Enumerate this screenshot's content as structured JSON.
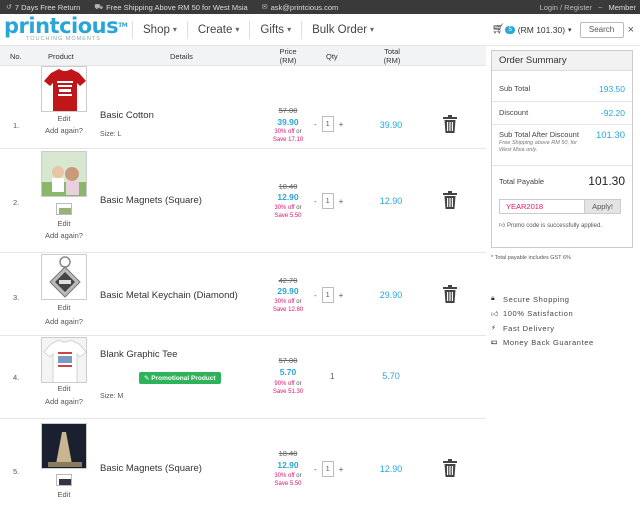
{
  "topbar": {
    "return_text": "7 Days Free Return",
    "shipping_text": "Free Shipping Above RM 50 for West Msia",
    "email": "ask@printcious.com",
    "login": "Login / Register",
    "separator": "~",
    "member": "Member"
  },
  "navbar": {
    "logo_text": "printcious",
    "logo_tm": "TM",
    "logo_tagline": "TOUCHING MOMENTS",
    "menu": [
      {
        "label": "Shop"
      },
      {
        "label": "Create"
      },
      {
        "label": "Gifts"
      },
      {
        "label": "Bulk Order"
      }
    ],
    "cart_count": "5",
    "cart_total": "(RM 101.30)",
    "search_label": "Search",
    "close_glyph": "×"
  },
  "table": {
    "headers": {
      "no": "No.",
      "product": "Product",
      "details": "Details",
      "price": "Price",
      "price_unit": "(RM)",
      "qty": "Qty",
      "total": "Total",
      "total_unit": "(RM)"
    },
    "edit_label": "Edit",
    "again_label": "Add again?",
    "or_label": "or",
    "items": [
      {
        "no": "1.",
        "name": "Basic Cotton",
        "size": "Size: L",
        "old_price": "57.00",
        "price": "39.90",
        "pct_off": "30% off",
        "save": "Save 17.10",
        "qty": "1",
        "total": "39.90",
        "minus": "-",
        "plus": "+"
      },
      {
        "no": "2.",
        "name": "Basic Magnets (Square)",
        "size": "",
        "old_price": "18.40",
        "price": "12.90",
        "pct_off": "30% off",
        "save": "Save 5.50",
        "qty": "1",
        "total": "12.90",
        "minus": "-",
        "plus": "+"
      },
      {
        "no": "3.",
        "name": "Basic Metal Keychain (Diamond)",
        "size": "",
        "old_price": "42.70",
        "price": "29.90",
        "pct_off": "30% off",
        "save": "Save 12.80",
        "qty": "1",
        "total": "29.90",
        "minus": "-",
        "plus": "+"
      },
      {
        "no": "4.",
        "name": "Blank Graphic Tee",
        "size": "Size: M",
        "badge": "Promotional Product",
        "old_price": "57.00",
        "price": "5.70",
        "pct_off": "90% off",
        "save": "Save 51.30",
        "qty": "1",
        "total": "5.70"
      },
      {
        "no": "5.",
        "name": "Basic Magnets (Square)",
        "size": "",
        "old_price": "18.40",
        "price": "12.90",
        "pct_off": "30% off",
        "save": "Save 5.50",
        "qty": "1",
        "total": "12.90",
        "minus": "-",
        "plus": "+"
      }
    ]
  },
  "summary": {
    "title": "Order Summary",
    "subtotal_label": "Sub Total",
    "subtotal": "193.50",
    "discount_label": "Discount",
    "discount": "-92.20",
    "after_label": "Sub Total After Discount",
    "after": "101.30",
    "free_note": "Free Shipping above RM 50, for West Msia only.",
    "payable_label": "Total Payable",
    "payable": "101.30",
    "promo_code": "YEAR2018",
    "apply_label": "Apply!",
    "promo_msg": "Promo code is successfully applied.",
    "gst_note": "* Total payable includes GST 6%"
  },
  "assurances": [
    {
      "label": "Secure Shopping",
      "icon": "lock-icon"
    },
    {
      "label": "100% Satisfaction",
      "icon": "thumbs-up-icon"
    },
    {
      "label": "Fast Delivery",
      "icon": "bolt-icon"
    },
    {
      "label": "Money Back Guarantee",
      "icon": "money-icon"
    }
  ],
  "colors": {
    "accent": "#2aa6d6",
    "discount": "#e0146e",
    "promo_badge": "#2fb35a",
    "topbar": "#3a3a3a"
  }
}
